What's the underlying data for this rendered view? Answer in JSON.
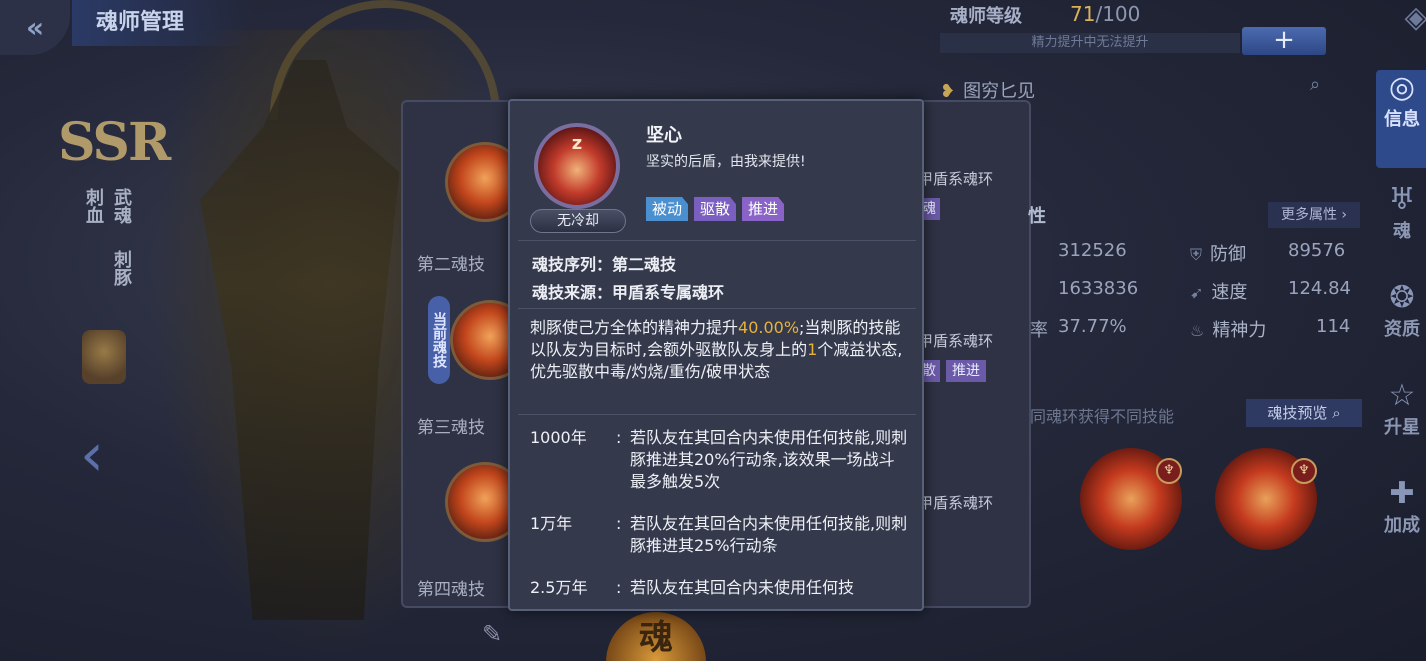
{
  "header": {
    "title": "魂师管理",
    "back_icon": "double-chevron-left-icon"
  },
  "hero": {
    "rarity": "SSR",
    "class_label": "刺血",
    "spirit_label": "武魂",
    "spirit_name": "刺豚"
  },
  "level": {
    "label": "魂师等级",
    "current": "71",
    "max": "/100",
    "bar_text": "精力提升中无法提升",
    "plus": "+"
  },
  "section": {
    "title": "图穷匕见"
  },
  "skills": [
    {
      "label": "第二魂技",
      "side_text": "甲盾系魂环",
      "tag": "魂"
    },
    {
      "label": "第三魂技",
      "side_text": "甲盾系魂环",
      "tag1": "散",
      "tag2": "推进",
      "current_badge": "当前魂技"
    },
    {
      "label": "第四魂技",
      "side_text": "甲盾系魂环"
    }
  ],
  "attributes": {
    "header": "性",
    "more_button": "更多属性",
    "rows": [
      {
        "value1": "312526",
        "name2": "防御",
        "value2": "89576"
      },
      {
        "value1": "1633836",
        "name2": "速度",
        "value2": "124.84"
      },
      {
        "prefix": "率",
        "value1": "37.77%",
        "name2": "精神力",
        "value2": "114"
      }
    ]
  },
  "preview": {
    "hint": "同魂环获得不同技能",
    "button": "魂技预览"
  },
  "sidebar": [
    "信息",
    "魂",
    "资质",
    "升星",
    "加成"
  ],
  "bottom": {
    "soul_text": "魂"
  },
  "popup": {
    "skill_name": "坚心",
    "motto": "坚实的后盾，由我来提供!",
    "cooldown": "无冷却",
    "tags": [
      {
        "label": "被动",
        "color": "#4a8fd0"
      },
      {
        "label": "驱散",
        "color": "#7b5fc0"
      },
      {
        "label": "推进",
        "color": "#8a63c9"
      }
    ],
    "order_line": "魂技序列：第二魂技",
    "source_line": "魂技来源：甲盾系专属魂环",
    "desc_before": "刺豚使己方全体的精神力提升",
    "desc_pct": "40.00%",
    "desc_mid": ";当刺豚的技能以队友为目标时,会额外驱散队友身上的",
    "desc_count": "1",
    "desc_after": "个减益状态,优先驱散中毒/灼烧/重伤/破甲状态",
    "years": [
      {
        "year": "1000年",
        "text": "若队友在其回合内未使用任何技能,则刺豚推进其20%行动条,该效果一场战斗最多触发5次"
      },
      {
        "year": "1万年",
        "text": "若队友在其回合内未使用任何技能,则刺豚推进其25%行动条"
      },
      {
        "year": "2.5万年",
        "text": "若队友在其回合内未使用任何技"
      }
    ]
  }
}
